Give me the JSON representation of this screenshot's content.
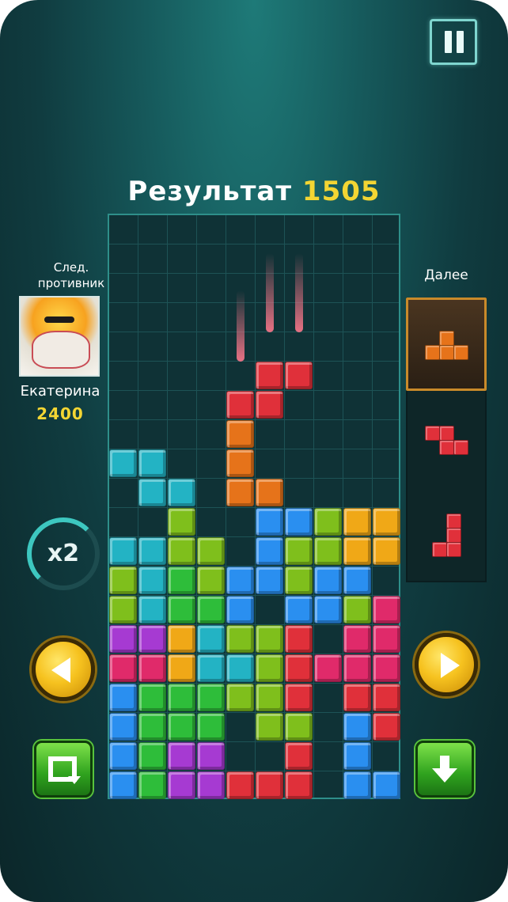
{
  "score": {
    "label": "Результат",
    "value": "1505"
  },
  "opponent": {
    "label_line1": "След.",
    "label_line2": "противник",
    "name": "Екатерина",
    "score": "2400"
  },
  "multiplier": "x2",
  "next": {
    "label": "Далее"
  },
  "icons": {
    "pause": "pause-icon",
    "left": "arrow-left-icon",
    "right": "arrow-right-icon",
    "rotate": "rotate-icon",
    "drop": "arrow-down-icon"
  },
  "board": {
    "cols": 10,
    "rows": 20,
    "colors": {
      "c": "#23b3c4",
      "g": "#7fbf1c",
      "G": "#2ebd3a",
      "b": "#2a8ff0",
      "y": "#f0a817",
      "r": "#e0303a",
      "p": "#a63ad2",
      "m": "#e02a6a",
      "o": "#e6731a"
    },
    "grid": [
      "..........",
      "..........",
      "..........",
      "..........",
      "..........",
      ".....rr...",
      "....rr....",
      "....o.....",
      "cc..o.....",
      ".cc.oo....",
      "..g..bbgyy",
      "ccgg.bggyy",
      "gcGgbbgbb.",
      "gcGGb.bbgm",
      "ppycggr.mm",
      "mmyccgrmmm",
      "bGGGggr.rr",
      "bGGG.gg.br",
      "bGpp..r.b.",
      "bGpprrr.bb"
    ]
  },
  "next_pieces": [
    {
      "color": "#e6731a",
      "cells": [
        [
          1,
          0
        ],
        [
          0,
          1
        ],
        [
          1,
          1
        ],
        [
          2,
          1
        ]
      ]
    },
    {
      "color": "#e0303a",
      "cells": [
        [
          0,
          0
        ],
        [
          1,
          0
        ],
        [
          1,
          1
        ],
        [
          2,
          1
        ]
      ]
    },
    {
      "color": "#e0303a",
      "cells": [
        [
          1,
          0
        ],
        [
          1,
          1
        ],
        [
          0,
          2
        ],
        [
          1,
          2
        ]
      ]
    }
  ]
}
